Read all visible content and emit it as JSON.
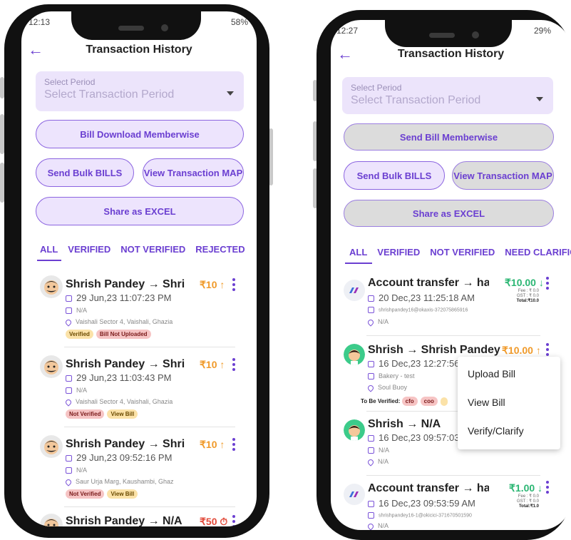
{
  "left": {
    "status": {
      "time": "12:13",
      "battery": "58%"
    },
    "header": {
      "title": "Transaction History"
    },
    "period": {
      "label": "Select Period",
      "placeholder": "Select Transaction Period"
    },
    "buttons": {
      "download": "Bill Download Memberwise",
      "bulk": "Send Bulk BILLS",
      "map": "View Transaction MAP",
      "excel": "Share as EXCEL"
    },
    "tabs": [
      "ALL",
      "VERIFIED",
      "NOT VERIFIED",
      "REJECTED"
    ],
    "cards": [
      {
        "title": "Shrish Pandey → Shri",
        "amount": "₹10 ↑",
        "date": "29 Jun,23 11:07:23 PM",
        "note": "N/A",
        "location": "Vaishali Sector 4, Vaishali, Ghazia",
        "badges": [
          "Verified",
          "Bill Not Uploaded"
        ]
      },
      {
        "title": "Shrish Pandey → Shri",
        "amount": "₹10 ↑",
        "date": "29 Jun,23 11:03:43 PM",
        "note": "N/A",
        "location": "Vaishali Sector 4, Vaishali, Ghazia",
        "badges": [
          "Not Verified",
          "View Bill"
        ]
      },
      {
        "title": "Shrish Pandey → Shri",
        "amount": "₹10 ↑",
        "date": "29 Jun,23 09:52:16 PM",
        "note": "N/A",
        "location": "Saur Urja Marg, Kaushambi, Ghaz",
        "badges": [
          "Not Verified",
          "View Bill"
        ]
      },
      {
        "title": "Shrish Pandey → N/A",
        "amount": "₹50 ⏱"
      }
    ]
  },
  "right": {
    "status": {
      "time": "12:27",
      "battery": "29%"
    },
    "header": {
      "title": "Transaction History"
    },
    "period": {
      "label": "Select Period",
      "placeholder": "Select Transaction Period"
    },
    "buttons": {
      "send": "Send Bill Memberwise",
      "bulk": "Send Bulk BILLS",
      "map": "View Transaction MAP",
      "excel": "Share as EXCEL"
    },
    "tabs": [
      "ALL",
      "VERIFIED",
      "NOT VERIFIED",
      "NEED CLARIFICA"
    ],
    "cards": [
      {
        "title": "Account transfer → haeyw",
        "amount": "₹10.00 ↓",
        "fee": "Fee : ₹ 0.0",
        "gst": "GST : ₹ 0.0",
        "total": "Total:₹10.0",
        "date": "20 Dec,23 11:25:18 AM",
        "note": "shrishpandey16@okaxis-372075865916",
        "location": "N/A"
      },
      {
        "title": "Shrish → Shrish Pandey",
        "amount": "₹10.00 ↑",
        "date": "16 Dec,23 12:27:56",
        "note": "Bakery - test",
        "location": "Soul Buoy",
        "verify_label": "To Be Verified:",
        "badges": [
          "cfo",
          "coo"
        ]
      },
      {
        "title": "Shrish → N/A",
        "date": "16 Dec,23 09:57:03",
        "note": "N/A",
        "location": "N/A"
      },
      {
        "title": "Account transfer → haeyw",
        "amount": "₹1.00 ↓",
        "fee": "Fee : ₹ 0.0",
        "gst": "GST : ₹ 0.0",
        "total": "Total:₹1.0",
        "date": "16 Dec,23 09:53:59 AM",
        "note": "shrishpandey16-1@okicici-371670501590",
        "location": "N/A"
      }
    ],
    "menu": [
      "Upload Bill",
      "View Bill",
      "Verify/Clarify"
    ]
  },
  "colors": {
    "accent": "#6b3fd1",
    "orange": "#f09a2a",
    "green": "#2bb673"
  },
  "icons": [
    "back-arrow-icon",
    "calendar-icon",
    "note-icon",
    "location-pin-icon",
    "kebab-menu-icon",
    "caret-down-icon"
  ]
}
